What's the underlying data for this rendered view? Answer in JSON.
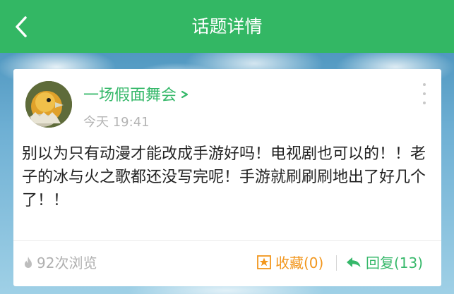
{
  "header": {
    "title": "话题详情"
  },
  "post": {
    "username": "一场假面舞会",
    "time": "今天 19:41",
    "content": "别以为只有动漫才能改成手游好吗！电视剧也可以的！！老子的冰与火之歌都还没写完呢！手游就刷刷刷地出了好几个了！！"
  },
  "footer": {
    "views": "92次浏览",
    "favorite": "收藏(0)",
    "reply": "回复(13)"
  },
  "colors": {
    "header_bg": "#33b764",
    "accent_green": "#36b86a",
    "favorite_orange": "#f2961c",
    "muted_gray": "#b0b0b0"
  },
  "icons": {
    "back": "chevron-left-icon",
    "more": "more-vertical-icon",
    "username_arrow": "chevron-right-icon",
    "views": "flame-icon",
    "favorite": "star-icon",
    "reply": "reply-arrow-icon"
  }
}
